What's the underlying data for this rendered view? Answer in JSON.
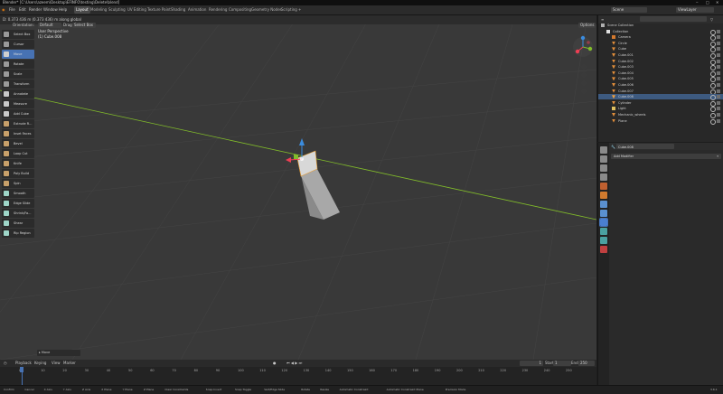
{
  "title": "Blender* [C:\\Users\\azeem\\Desktop\\EFINFO\\testing\\Delete\\blend]",
  "menus": [
    "File",
    "Edit",
    "Render",
    "Window",
    "Help"
  ],
  "workspaces": [
    "Layout",
    "Modeling",
    "Sculpting",
    "UV Editing",
    "Texture Paint",
    "Shading",
    "Animation",
    "Rendering",
    "Compositing",
    "Geometry Nodes",
    "Scripting"
  ],
  "active_workspace": "Layout",
  "top_right": {
    "scene": "Scene",
    "view_layer": "ViewLayer"
  },
  "status_line": "D: 0.373 436 m (0.373 436) m along global",
  "viewport_header": {
    "orientation_label": "Orientation:",
    "orientation_value": "Default",
    "drag_label": "Drag:",
    "drag_value": "Select Box",
    "options": "Options"
  },
  "viewport": {
    "perspective": "User Perspective",
    "object": "(1) Cube.008"
  },
  "tools": [
    {
      "label": "Select Box",
      "active": false,
      "color": "#9a9a9a"
    },
    {
      "label": "Cursor",
      "active": false,
      "color": "#9a9a9a"
    },
    {
      "label": "Move",
      "active": true,
      "color": "#d0d0d0"
    },
    {
      "label": "Rotate",
      "active": false,
      "color": "#9a9a9a"
    },
    {
      "label": "Scale",
      "active": false,
      "color": "#9a9a9a"
    },
    {
      "label": "Transform",
      "active": false,
      "color": "#9a9a9a"
    },
    {
      "label": "Annotate",
      "active": false,
      "color": "#c8c8c8"
    },
    {
      "label": "Measure",
      "active": false,
      "color": "#c8c8c8"
    },
    {
      "label": "Add Cube",
      "active": false,
      "color": "#c8c8c8"
    },
    {
      "label": "Extrude R...",
      "active": false,
      "color": "#c8a06a"
    },
    {
      "label": "Inset Faces",
      "active": false,
      "color": "#c8a06a"
    },
    {
      "label": "Bevel",
      "active": false,
      "color": "#c8a06a"
    },
    {
      "label": "Loop Cut",
      "active": false,
      "color": "#c8a06a"
    },
    {
      "label": "Knife",
      "active": false,
      "color": "#c8a06a"
    },
    {
      "label": "Poly Build",
      "active": false,
      "color": "#c8a06a"
    },
    {
      "label": "Spin",
      "active": false,
      "color": "#c8a06a"
    },
    {
      "label": "Smooth",
      "active": false,
      "color": "#9ed6c8"
    },
    {
      "label": "Edge Slide",
      "active": false,
      "color": "#9ed6c8"
    },
    {
      "label": "Shrink/Fa...",
      "active": false,
      "color": "#9ed6c8"
    },
    {
      "label": "Shear",
      "active": false,
      "color": "#9ed6c8"
    },
    {
      "label": "Rip Region",
      "active": false,
      "color": "#9ed6c8"
    }
  ],
  "last_op": "Move",
  "timeline": {
    "menus": [
      "Playback",
      "Keying",
      "View",
      "Marker"
    ],
    "current_frame": "1",
    "start_label": "Start",
    "start": "1",
    "end_label": "End",
    "end": "250",
    "ticks": [
      "0",
      "10",
      "20",
      "30",
      "40",
      "50",
      "60",
      "70",
      "80",
      "90",
      "100",
      "110",
      "120",
      "130",
      "140",
      "150",
      "160",
      "170",
      "180",
      "190",
      "200",
      "210",
      "220",
      "230",
      "240",
      "250"
    ]
  },
  "outliner": {
    "search_placeholder": "",
    "rows": [
      {
        "label": "Scene Collection",
        "indent": 0,
        "type": "scene"
      },
      {
        "label": "Collection",
        "indent": 1,
        "type": "collection"
      },
      {
        "label": "Camera",
        "indent": 2,
        "type": "camera"
      },
      {
        "label": "Circle",
        "indent": 2,
        "type": "mesh"
      },
      {
        "label": "Cube",
        "indent": 2,
        "type": "mesh"
      },
      {
        "label": "Cube.001",
        "indent": 2,
        "type": "mesh"
      },
      {
        "label": "Cube.002",
        "indent": 2,
        "type": "mesh"
      },
      {
        "label": "Cube.003",
        "indent": 2,
        "type": "mesh"
      },
      {
        "label": "Cube.004",
        "indent": 2,
        "type": "mesh"
      },
      {
        "label": "Cube.005",
        "indent": 2,
        "type": "mesh"
      },
      {
        "label": "Cube.006",
        "indent": 2,
        "type": "mesh"
      },
      {
        "label": "Cube.007",
        "indent": 2,
        "type": "mesh"
      },
      {
        "label": "Cube.008",
        "indent": 2,
        "type": "mesh-active"
      },
      {
        "label": "Cylinder",
        "indent": 2,
        "type": "mesh"
      },
      {
        "label": "Light",
        "indent": 2,
        "type": "light"
      },
      {
        "label": "Mechanic_wheels",
        "indent": 2,
        "type": "mesh"
      },
      {
        "label": "Plane",
        "indent": 2,
        "type": "mesh"
      }
    ]
  },
  "properties": {
    "object_name": "Cube.008",
    "add_modifier": "Add Modifier"
  },
  "statusbar": [
    "Confirm",
    "Cancel",
    "X Axis",
    "Y Axis",
    "Z Axis",
    "X Plane",
    "Y Plane",
    "Z Plane",
    "Clear Constraints",
    "Snap Invert",
    "Snap Toggle",
    "Vert/Edge Slide",
    "Rotate",
    "Resize",
    "Automatic Constraint",
    "Automatic Constraint Plane",
    "Precision Mode"
  ],
  "version": "3.6.1",
  "colors": {
    "accent": "#4772b3",
    "x_axis": "#ed3e53",
    "y_axis": "#82bd2a",
    "z_axis": "#3b8cde",
    "highlight": "#3d5a80"
  }
}
